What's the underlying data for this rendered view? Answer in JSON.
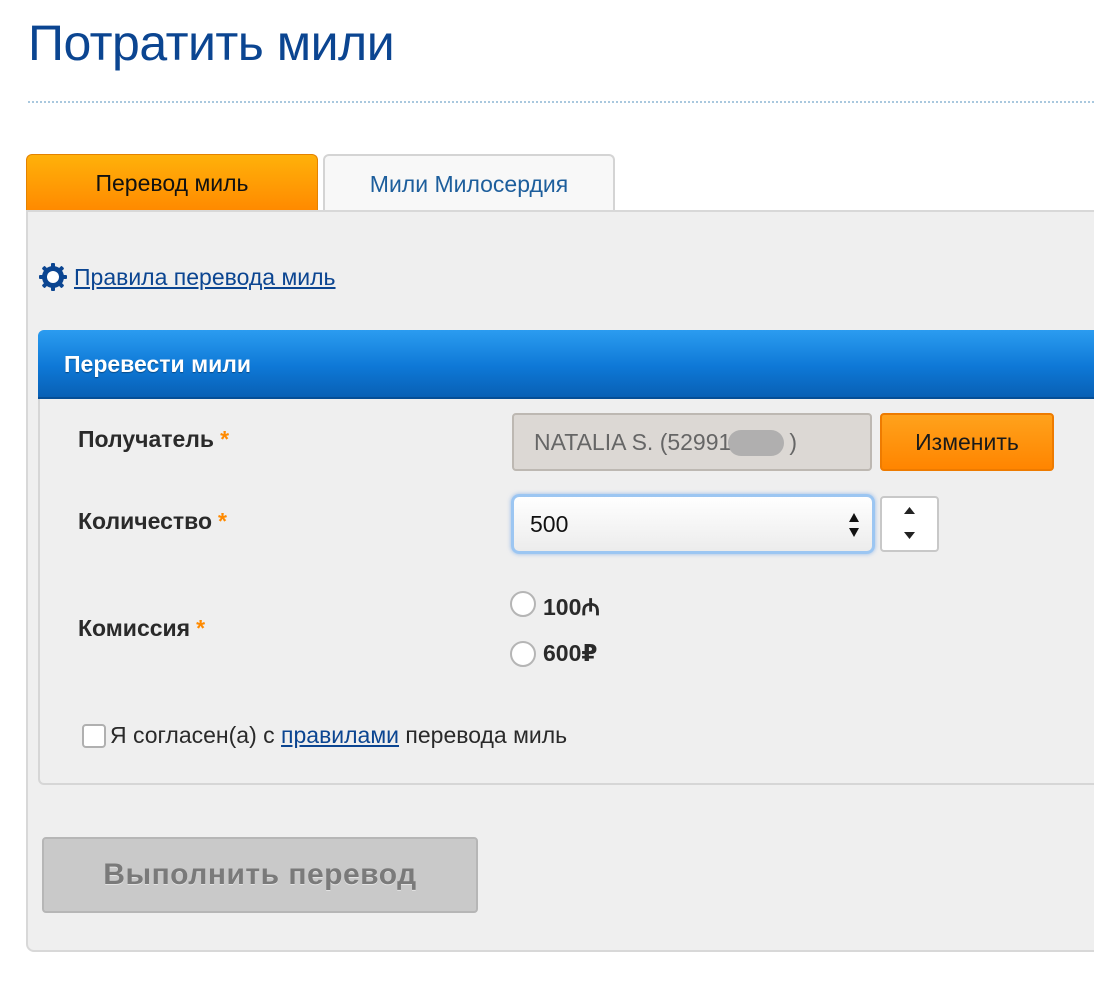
{
  "page": {
    "title": "Потратить мили"
  },
  "tabs": [
    {
      "label": "Перевод миль",
      "active": true
    },
    {
      "label": "Мили Милосердия",
      "active": false
    }
  ],
  "rules_link": {
    "label": "Правила перевода миль",
    "icon": "gear-icon"
  },
  "form": {
    "header": "Перевести мили",
    "required_mark": "*",
    "recipient": {
      "label": "Получатель",
      "value": "NATALIA S. (52991",
      "value_end": ")",
      "change_label": "Изменить"
    },
    "quantity": {
      "label": "Количество",
      "value": "500"
    },
    "commission": {
      "label": "Комиссия",
      "options": [
        {
          "amount": "100",
          "currency": "₼",
          "selected": false
        },
        {
          "amount": "600",
          "currency": "₽",
          "selected": false
        }
      ]
    },
    "agreement": {
      "prefix": "Я согласен(а) с ",
      "link": "правилами",
      "suffix": " перевода миль",
      "checked": false
    }
  },
  "submit": {
    "label": "Выполнить перевод"
  },
  "colors": {
    "title": "#0b4591",
    "accent_orange": "#ff8a00",
    "header_blue": "#0e78d6",
    "link": "#0b4591",
    "disabled_button": "#c9c9c9"
  }
}
